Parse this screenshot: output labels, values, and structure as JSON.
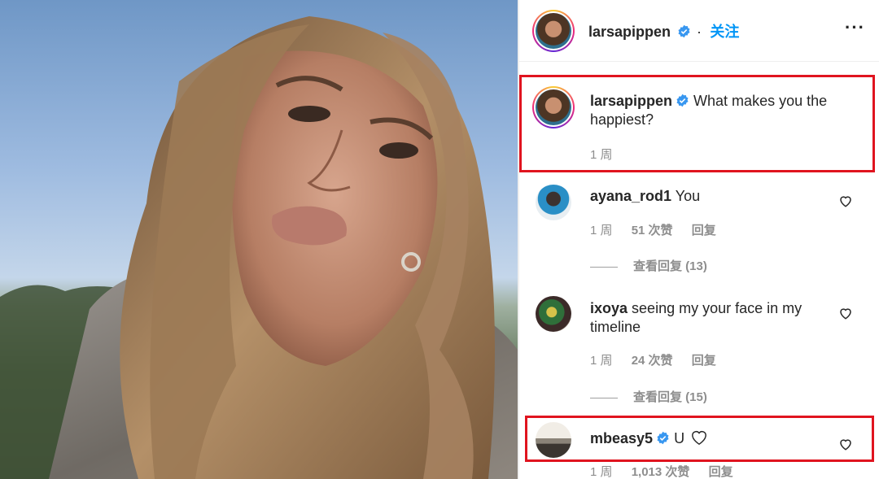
{
  "header": {
    "username": "larsapippen",
    "follow_label": "关注",
    "more_icon": "more-horizontal-icon"
  },
  "caption": {
    "username": "larsapippen",
    "text": "What makes you the happiest?",
    "time": "1 周"
  },
  "comments": [
    {
      "username": "ayana_rod1",
      "text": "You",
      "time": "1 周",
      "likes": "51 次赞",
      "reply": "回复",
      "view_replies": "查看回复 (13)"
    },
    {
      "username": "ixoya",
      "text": "seeing my your face in my timeline",
      "time": "1 周",
      "likes": "24 次赞",
      "reply": "回复",
      "view_replies": "查看回复 (15)"
    },
    {
      "username": "mbeasy5",
      "text": "U",
      "time": "1 周",
      "likes": "1,013 次赞",
      "reply": "回复"
    }
  ],
  "colors": {
    "accent": "#0095f6",
    "highlight_box": "#e0141f",
    "verified": "#3897f0"
  }
}
